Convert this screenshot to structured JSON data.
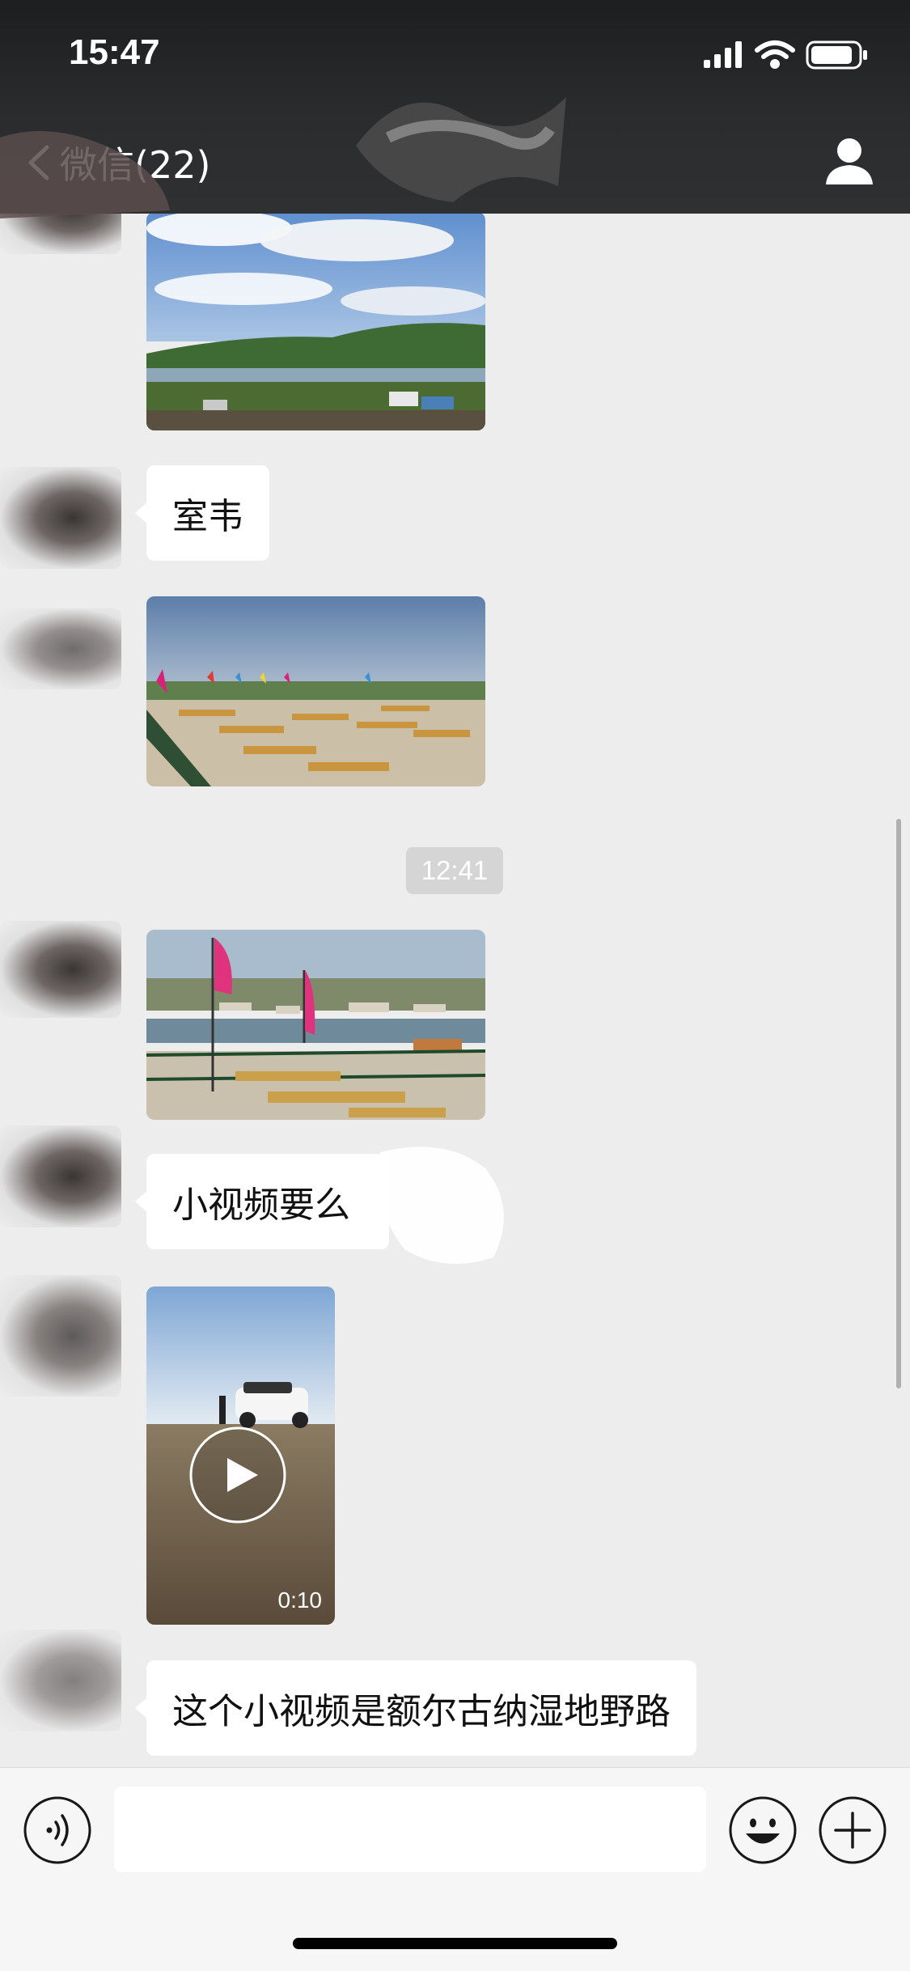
{
  "status_bar": {
    "time": "15:47",
    "icons": [
      "cellular-signal-icon",
      "wifi-icon",
      "battery-icon"
    ]
  },
  "nav": {
    "back_label": "微信(22)",
    "profile_icon": "person-icon"
  },
  "messages": [
    {
      "type": "image",
      "content": "grassland-lake-photo"
    },
    {
      "type": "text",
      "text": "室韦"
    },
    {
      "type": "image",
      "content": "picnic-tables-flags-photo"
    },
    {
      "type": "time",
      "text": "12:41"
    },
    {
      "type": "image",
      "content": "picnic-tables-pink-flags-photo"
    },
    {
      "type": "text",
      "text": "小视频要么"
    },
    {
      "type": "video",
      "duration": "0:10"
    },
    {
      "type": "text",
      "text": "这个小视频是额尔古纳湿地野路"
    }
  ],
  "input_bar": {
    "voice_icon": "voice-icon",
    "text_value": "",
    "emoji_icon": "emoji-icon",
    "add_icon": "plus-icon"
  },
  "colors": {
    "chat_background": "#ededed",
    "header_background": "#2e2f31",
    "bubble": "#ffffff",
    "timestamp_background": "#d5d5d5"
  }
}
